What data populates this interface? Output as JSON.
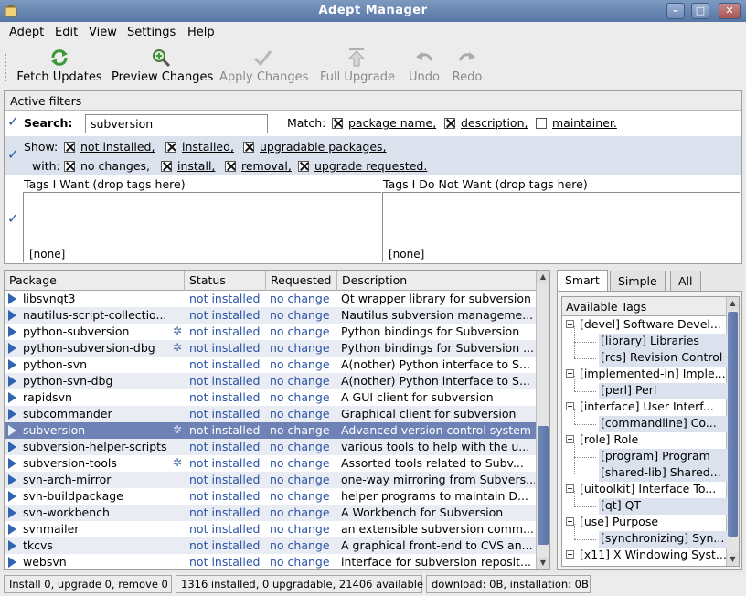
{
  "window": {
    "title": "Adept Manager"
  },
  "menu": [
    "Adept",
    "Edit",
    "View",
    "Settings",
    "Help"
  ],
  "toolbar": {
    "fetch_updates": "Fetch Updates",
    "preview_changes": "Preview Changes",
    "apply_changes": "Apply Changes",
    "full_upgrade": "Full Upgrade",
    "undo": "Undo",
    "redo": "Redo"
  },
  "filters": {
    "header": "Active filters",
    "search_label": "Search:",
    "search_value": "subversion",
    "match_label": "Match:",
    "match_options": [
      {
        "label": "package name,",
        "checked": true
      },
      {
        "label": "description,",
        "checked": true
      },
      {
        "label": "maintainer.",
        "checked": false
      }
    ],
    "show_label": "Show:",
    "show_options": [
      {
        "label": "not installed,",
        "checked": true
      },
      {
        "label": "installed,",
        "checked": true
      },
      {
        "label": "upgradable packages,",
        "checked": true
      }
    ],
    "with_label": "with:",
    "with_options": [
      {
        "label": "no changes,",
        "checked": true
      },
      {
        "label": "install,",
        "checked": true
      },
      {
        "label": "removal,",
        "checked": true
      },
      {
        "label": "upgrade requested.",
        "checked": true
      }
    ],
    "tags_want_label": "Tags I Want (drop tags here)",
    "tags_not_want_label": "Tags I Do Not Want (drop tags here)",
    "tags_want_value": "[none]",
    "tags_not_want_value": "[none]"
  },
  "packages": {
    "columns": [
      "Package",
      "Status",
      "Requested",
      "Description"
    ],
    "rows": [
      {
        "name": "libsvnqt3",
        "status": "not installed",
        "requested": "no change",
        "description": "Qt wrapper library for subversion",
        "gear": false
      },
      {
        "name": "nautilus-script-collectio...",
        "status": "not installed",
        "requested": "no change",
        "description": "Nautilus subversion manageme...",
        "gear": false
      },
      {
        "name": "python-subversion",
        "status": "not installed",
        "requested": "no change",
        "description": "Python bindings for Subversion",
        "gear": true
      },
      {
        "name": "python-subversion-dbg",
        "status": "not installed",
        "requested": "no change",
        "description": "Python bindings for Subversion ...",
        "gear": true
      },
      {
        "name": "python-svn",
        "status": "not installed",
        "requested": "no change",
        "description": "A(nother) Python interface to S...",
        "gear": false
      },
      {
        "name": "python-svn-dbg",
        "status": "not installed",
        "requested": "no change",
        "description": "A(nother) Python interface to S...",
        "gear": false
      },
      {
        "name": "rapidsvn",
        "status": "not installed",
        "requested": "no change",
        "description": "A GUI client for subversion",
        "gear": false
      },
      {
        "name": "subcommander",
        "status": "not installed",
        "requested": "no change",
        "description": "Graphical client for subversion",
        "gear": false
      },
      {
        "name": "subversion",
        "status": "not installed",
        "requested": "no change",
        "description": "Advanced version control system",
        "gear": true,
        "selected": true
      },
      {
        "name": "subversion-helper-scripts",
        "status": "not installed",
        "requested": "no change",
        "description": "various tools to help with the u...",
        "gear": false
      },
      {
        "name": "subversion-tools",
        "status": "not installed",
        "requested": "no change",
        "description": "Assorted tools related to Subv...",
        "gear": true
      },
      {
        "name": "svn-arch-mirror",
        "status": "not installed",
        "requested": "no change",
        "description": "one-way mirroring from Subvers...",
        "gear": false
      },
      {
        "name": "svn-buildpackage",
        "status": "not installed",
        "requested": "no change",
        "description": "helper programs to maintain D...",
        "gear": false
      },
      {
        "name": "svn-workbench",
        "status": "not installed",
        "requested": "no change",
        "description": "A Workbench for Subversion",
        "gear": false
      },
      {
        "name": "svnmailer",
        "status": "not installed",
        "requested": "no change",
        "description": "an extensible subversion comm...",
        "gear": false
      },
      {
        "name": "tkcvs",
        "status": "not installed",
        "requested": "no change",
        "description": "A graphical front-end to CVS an...",
        "gear": false
      },
      {
        "name": "websvn",
        "status": "not installed",
        "requested": "no change",
        "description": "interface for subversion reposit...",
        "gear": false
      }
    ]
  },
  "tags": {
    "tabs": [
      "Smart",
      "Simple",
      "All"
    ],
    "header": "Available Tags",
    "items": [
      {
        "label": "[devel] Software Devel...",
        "level": 0
      },
      {
        "label": "[library] Libraries",
        "level": 1
      },
      {
        "label": "[rcs] Revision Control",
        "level": 1
      },
      {
        "label": "[implemented-in] Imple...",
        "level": 0
      },
      {
        "label": "[perl] Perl",
        "level": 1
      },
      {
        "label": "[interface] User Interf...",
        "level": 0
      },
      {
        "label": "[commandline] Co...",
        "level": 1
      },
      {
        "label": "[role] Role",
        "level": 0
      },
      {
        "label": "[program] Program",
        "level": 1
      },
      {
        "label": "[shared-lib] Shared...",
        "level": 1
      },
      {
        "label": "[uitoolkit] Interface To...",
        "level": 0
      },
      {
        "label": "[qt] QT",
        "level": 1
      },
      {
        "label": "[use] Purpose",
        "level": 0
      },
      {
        "label": "[synchronizing] Syn...",
        "level": 1
      },
      {
        "label": "[x11] X Windowing Syst...",
        "level": 0
      }
    ]
  },
  "status": {
    "changes": "Install 0, upgrade 0, remove 0",
    "counts": "1316 installed, 0 upgradable, 21406 available",
    "download": "download: 0B, installation: 0B"
  }
}
